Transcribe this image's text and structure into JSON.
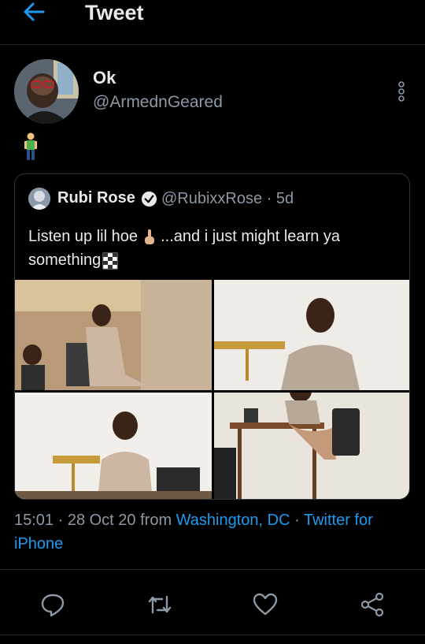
{
  "header": {
    "title": "Tweet"
  },
  "tweet": {
    "author_name": "Ok",
    "author_handle": "@ArmednGeared"
  },
  "quoted": {
    "name": "Rubi Rose",
    "handle_time": "@RubixxRose · 5d",
    "text_part1": "Listen up lil hoe ",
    "text_part2": " ...and i just might learn ya something"
  },
  "meta": {
    "time_date": "15:01 · 28 Oct 20 from ",
    "location": "Washington, DC",
    "separator": " · ",
    "client": "Twitter for iPhone"
  },
  "actions": [
    "reply-icon",
    "retweet-icon",
    "like-icon",
    "share-icon"
  ],
  "colors": {
    "accent": "#1d9bf0",
    "secondary_text": "#8b98a5",
    "background": "#000000"
  }
}
